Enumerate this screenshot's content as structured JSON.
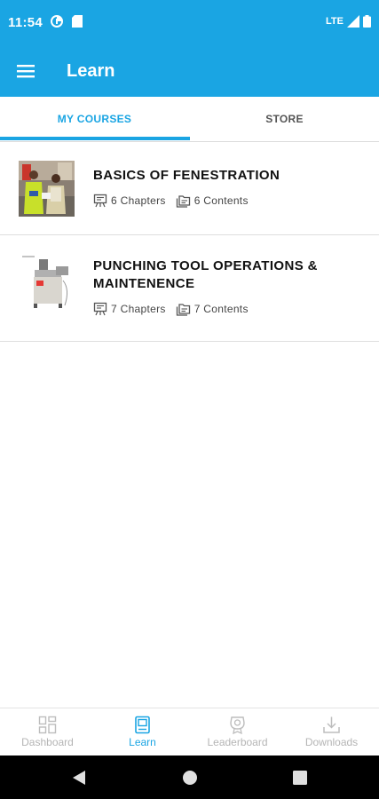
{
  "status_bar": {
    "time": "11:54",
    "network": "LTE"
  },
  "app_bar": {
    "title": "Learn",
    "menu_icon": "hamburger-menu-icon"
  },
  "tabs": [
    {
      "label": "MY COURSES",
      "active": true
    },
    {
      "label": "STORE",
      "active": false
    }
  ],
  "courses": [
    {
      "title": "BASICS OF FENESTRATION",
      "chapters": "6 Chapters",
      "contents": "6 Contents"
    },
    {
      "title": "PUNCHING TOOL OPERATIONS & MAINTENENCE",
      "chapters": "7 Chapters",
      "contents": "7 Contents"
    }
  ],
  "bottom_nav": [
    {
      "label": "Dashboard",
      "icon": "dashboard-icon",
      "active": false
    },
    {
      "label": "Learn",
      "icon": "book-icon",
      "active": true
    },
    {
      "label": "Leaderboard",
      "icon": "trophy-badge-icon",
      "active": false
    },
    {
      "label": "Downloads",
      "icon": "download-icon",
      "active": false
    }
  ],
  "colors": {
    "primary": "#1aa5e3",
    "inactive_nav": "#b5b5b5"
  }
}
